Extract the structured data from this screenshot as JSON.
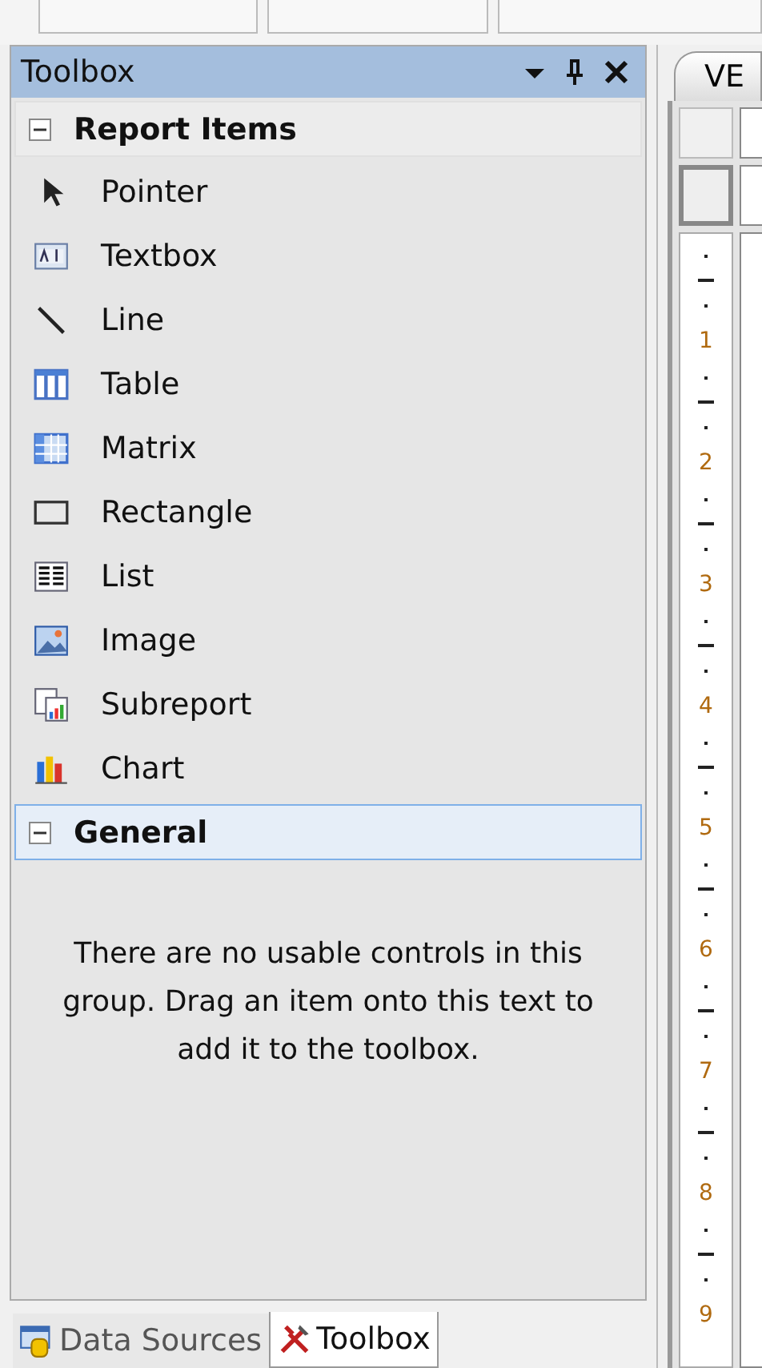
{
  "panel": {
    "title": "Toolbox"
  },
  "groups": [
    {
      "label": "Report Items",
      "expanded": true,
      "selected": false,
      "items": [
        {
          "label": "Pointer",
          "kind": "pointer"
        },
        {
          "label": "Textbox",
          "kind": "textbox"
        },
        {
          "label": "Line",
          "kind": "line"
        },
        {
          "label": "Table",
          "kind": "table"
        },
        {
          "label": "Matrix",
          "kind": "matrix"
        },
        {
          "label": "Rectangle",
          "kind": "rectangle"
        },
        {
          "label": "List",
          "kind": "list"
        },
        {
          "label": "Image",
          "kind": "image"
        },
        {
          "label": "Subreport",
          "kind": "subreport"
        },
        {
          "label": "Chart",
          "kind": "chart"
        }
      ]
    },
    {
      "label": "General",
      "expanded": true,
      "selected": true,
      "message": "There are no usable controls in this group. Drag an item onto this text to add it to the toolbox."
    }
  ],
  "bottom_tabs": [
    {
      "label": "Data Sources",
      "kind": "datasources",
      "selected": false
    },
    {
      "label": "Toolbox",
      "kind": "toolbox",
      "selected": true
    }
  ],
  "designer": {
    "tab": "VE",
    "ruler": [
      "1",
      "2",
      "3",
      "4",
      "5",
      "6",
      "7",
      "8",
      "9"
    ]
  }
}
